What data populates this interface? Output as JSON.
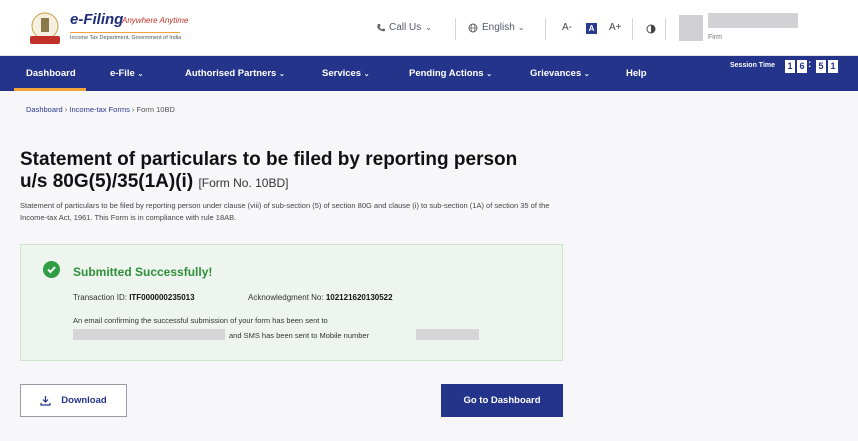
{
  "header": {
    "logo_title": "e-Filing",
    "logo_tagline": "Anywhere Anytime",
    "logo_subtitle": "Income Tax Department, Government of India",
    "call_us": "Call Us",
    "language": "English",
    "font_decrease": "A-",
    "font_default": "A",
    "font_increase": "A+",
    "user_role": "Firm"
  },
  "nav": {
    "items": [
      "Dashboard",
      "e-File",
      "Authorised Partners",
      "Services",
      "Pending Actions",
      "Grievances",
      "Help"
    ],
    "session_label": "Session Time",
    "session_digits": [
      "1",
      "6",
      "5",
      "1"
    ]
  },
  "breadcrumb": {
    "items": [
      "Dashboard",
      "Income-tax Forms",
      "Form 10BD"
    ]
  },
  "page": {
    "title_line1": "Statement of particulars to be filed by reporting person",
    "title_line2": "u/s 80G(5)/35(1A)(i)",
    "form_no": "[Form No. 10BD]",
    "description": "Statement of particulars to be filed by reporting person under clause (viii) of sub-section (5) of section 80G and clause (i) to sub-section (1A) of section 35 of the Income-tax Act, 1961. This Form is in compliance with rule 18AB."
  },
  "success": {
    "title": "Submitted Successfully!",
    "transaction_label": "Transaction ID:",
    "transaction_id": "ITF000000235013",
    "ack_label": "Acknowledgment No:",
    "ack_no": "102121620130522",
    "email_message": "An email confirming the successful submission of your form has been sent to",
    "sms_message": "and SMS has been sent to Mobile number"
  },
  "actions": {
    "download_label": "Download",
    "dashboard_label": "Go to Dashboard"
  },
  "colors": {
    "brand": "#24348b",
    "accent": "#f3a53b",
    "success": "#2f9e44"
  }
}
